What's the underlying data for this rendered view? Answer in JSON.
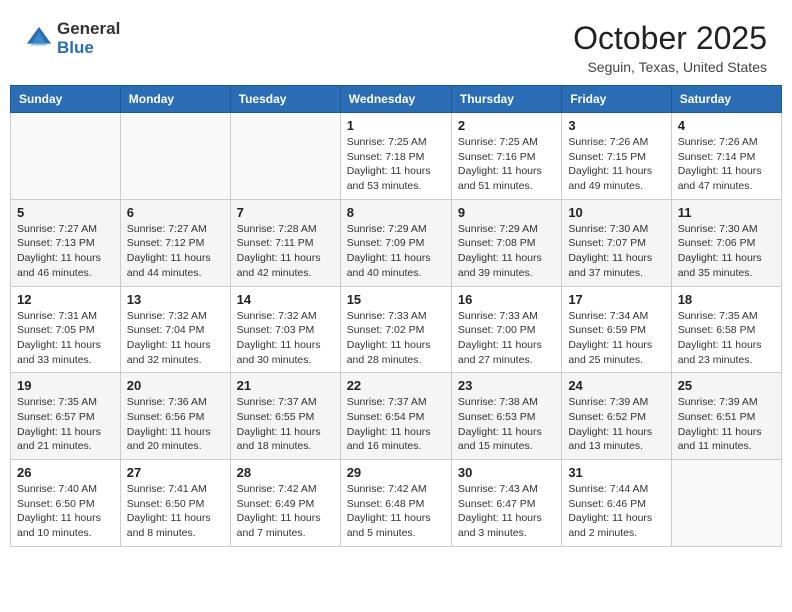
{
  "header": {
    "logo_general": "General",
    "logo_blue": "Blue",
    "month_title": "October 2025",
    "location": "Seguin, Texas, United States"
  },
  "days_of_week": [
    "Sunday",
    "Monday",
    "Tuesday",
    "Wednesday",
    "Thursday",
    "Friday",
    "Saturday"
  ],
  "weeks": [
    [
      {
        "day": "",
        "info": ""
      },
      {
        "day": "",
        "info": ""
      },
      {
        "day": "",
        "info": ""
      },
      {
        "day": "1",
        "info": "Sunrise: 7:25 AM\nSunset: 7:18 PM\nDaylight: 11 hours\nand 53 minutes."
      },
      {
        "day": "2",
        "info": "Sunrise: 7:25 AM\nSunset: 7:16 PM\nDaylight: 11 hours\nand 51 minutes."
      },
      {
        "day": "3",
        "info": "Sunrise: 7:26 AM\nSunset: 7:15 PM\nDaylight: 11 hours\nand 49 minutes."
      },
      {
        "day": "4",
        "info": "Sunrise: 7:26 AM\nSunset: 7:14 PM\nDaylight: 11 hours\nand 47 minutes."
      }
    ],
    [
      {
        "day": "5",
        "info": "Sunrise: 7:27 AM\nSunset: 7:13 PM\nDaylight: 11 hours\nand 46 minutes."
      },
      {
        "day": "6",
        "info": "Sunrise: 7:27 AM\nSunset: 7:12 PM\nDaylight: 11 hours\nand 44 minutes."
      },
      {
        "day": "7",
        "info": "Sunrise: 7:28 AM\nSunset: 7:11 PM\nDaylight: 11 hours\nand 42 minutes."
      },
      {
        "day": "8",
        "info": "Sunrise: 7:29 AM\nSunset: 7:09 PM\nDaylight: 11 hours\nand 40 minutes."
      },
      {
        "day": "9",
        "info": "Sunrise: 7:29 AM\nSunset: 7:08 PM\nDaylight: 11 hours\nand 39 minutes."
      },
      {
        "day": "10",
        "info": "Sunrise: 7:30 AM\nSunset: 7:07 PM\nDaylight: 11 hours\nand 37 minutes."
      },
      {
        "day": "11",
        "info": "Sunrise: 7:30 AM\nSunset: 7:06 PM\nDaylight: 11 hours\nand 35 minutes."
      }
    ],
    [
      {
        "day": "12",
        "info": "Sunrise: 7:31 AM\nSunset: 7:05 PM\nDaylight: 11 hours\nand 33 minutes."
      },
      {
        "day": "13",
        "info": "Sunrise: 7:32 AM\nSunset: 7:04 PM\nDaylight: 11 hours\nand 32 minutes."
      },
      {
        "day": "14",
        "info": "Sunrise: 7:32 AM\nSunset: 7:03 PM\nDaylight: 11 hours\nand 30 minutes."
      },
      {
        "day": "15",
        "info": "Sunrise: 7:33 AM\nSunset: 7:02 PM\nDaylight: 11 hours\nand 28 minutes."
      },
      {
        "day": "16",
        "info": "Sunrise: 7:33 AM\nSunset: 7:00 PM\nDaylight: 11 hours\nand 27 minutes."
      },
      {
        "day": "17",
        "info": "Sunrise: 7:34 AM\nSunset: 6:59 PM\nDaylight: 11 hours\nand 25 minutes."
      },
      {
        "day": "18",
        "info": "Sunrise: 7:35 AM\nSunset: 6:58 PM\nDaylight: 11 hours\nand 23 minutes."
      }
    ],
    [
      {
        "day": "19",
        "info": "Sunrise: 7:35 AM\nSunset: 6:57 PM\nDaylight: 11 hours\nand 21 minutes."
      },
      {
        "day": "20",
        "info": "Sunrise: 7:36 AM\nSunset: 6:56 PM\nDaylight: 11 hours\nand 20 minutes."
      },
      {
        "day": "21",
        "info": "Sunrise: 7:37 AM\nSunset: 6:55 PM\nDaylight: 11 hours\nand 18 minutes."
      },
      {
        "day": "22",
        "info": "Sunrise: 7:37 AM\nSunset: 6:54 PM\nDaylight: 11 hours\nand 16 minutes."
      },
      {
        "day": "23",
        "info": "Sunrise: 7:38 AM\nSunset: 6:53 PM\nDaylight: 11 hours\nand 15 minutes."
      },
      {
        "day": "24",
        "info": "Sunrise: 7:39 AM\nSunset: 6:52 PM\nDaylight: 11 hours\nand 13 minutes."
      },
      {
        "day": "25",
        "info": "Sunrise: 7:39 AM\nSunset: 6:51 PM\nDaylight: 11 hours\nand 11 minutes."
      }
    ],
    [
      {
        "day": "26",
        "info": "Sunrise: 7:40 AM\nSunset: 6:50 PM\nDaylight: 11 hours\nand 10 minutes."
      },
      {
        "day": "27",
        "info": "Sunrise: 7:41 AM\nSunset: 6:50 PM\nDaylight: 11 hours\nand 8 minutes."
      },
      {
        "day": "28",
        "info": "Sunrise: 7:42 AM\nSunset: 6:49 PM\nDaylight: 11 hours\nand 7 minutes."
      },
      {
        "day": "29",
        "info": "Sunrise: 7:42 AM\nSunset: 6:48 PM\nDaylight: 11 hours\nand 5 minutes."
      },
      {
        "day": "30",
        "info": "Sunrise: 7:43 AM\nSunset: 6:47 PM\nDaylight: 11 hours\nand 3 minutes."
      },
      {
        "day": "31",
        "info": "Sunrise: 7:44 AM\nSunset: 6:46 PM\nDaylight: 11 hours\nand 2 minutes."
      },
      {
        "day": "",
        "info": ""
      }
    ]
  ]
}
